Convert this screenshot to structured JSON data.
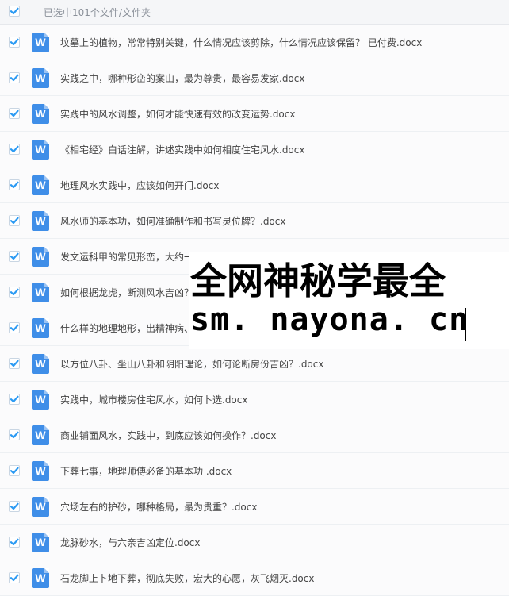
{
  "header": {
    "selection_label": "已选中101个文件/文件夹"
  },
  "icon": {
    "word_letter": "W",
    "checkbox_color": "#2b9af3",
    "word_color": "#3f8ee8"
  },
  "files": [
    {
      "name": "坟墓上的植物，常常特别关键，什么情况应该剪除，什么情况应该保留？ 已付费.docx"
    },
    {
      "name": "实践之中，哪种形峦的案山，最为尊贵，最容易发家.docx"
    },
    {
      "name": "实践中的风水调整，如何才能快速有效的改变运势.docx"
    },
    {
      "name": "《相宅经》白话注解，讲述实践中如何相度住宅风水.docx"
    },
    {
      "name": "地理风水实践中，应该如何开门.docx"
    },
    {
      "name": "风水师的基本功，如何准确制作和书写灵位牌？.docx"
    },
    {
      "name": "发文运科甲的常见形峦，大约一"
    },
    {
      "name": "如何根据龙虎，断测风水吉凶？"
    },
    {
      "name": "什么样的地理地形，出精神病、"
    },
    {
      "name": "以方位八卦、坐山八卦和阴阳理论，如何论断房份吉凶？.docx"
    },
    {
      "name": "实践中，城市楼房住宅风水，如何卜选.docx"
    },
    {
      "name": "商业铺面风水，实践中，到底应该如何操作？.docx"
    },
    {
      "name": "下葬七事，地理师傅必备的基本功 .docx"
    },
    {
      "name": "穴场左右的护砂，哪种格局，最为贵重？.docx"
    },
    {
      "name": "龙脉砂水，与六亲吉凶定位.docx"
    },
    {
      "name": "石龙脚上卜地下葬，彻底失败，宏大的心愿，灰飞烟灭.docx"
    }
  ],
  "overlay": {
    "line1": "全网神秘学最全",
    "line2": "sm. nayona. cn"
  }
}
